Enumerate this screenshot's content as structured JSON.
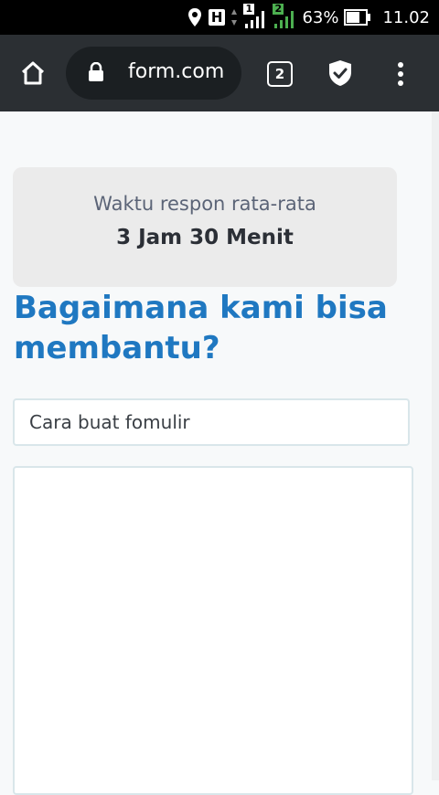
{
  "status_bar": {
    "network_badge": "H",
    "sim1": "1",
    "sim2": "2",
    "battery": "63%",
    "time": "11.02"
  },
  "browser": {
    "url": "form.com",
    "tab_count": "2"
  },
  "page": {
    "response_label": "Waktu respon rata-rata",
    "response_value": "3 Jam 30 Menit",
    "heading": "Bagaimana kami bisa membantu?",
    "subject_value": "Cara buat fomulir",
    "message_value": ""
  }
}
